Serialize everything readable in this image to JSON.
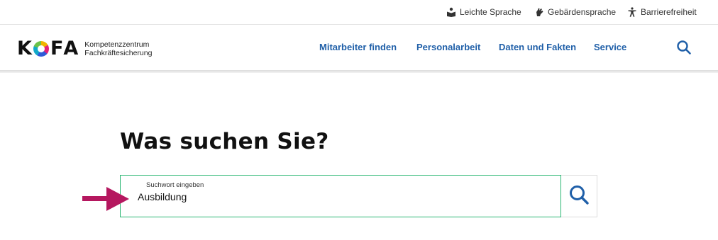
{
  "utility": {
    "easy_language": "Leichte Sprache",
    "sign_language": "Gebärdensprache",
    "accessibility": "Barrierefreiheit"
  },
  "logo": {
    "letter_k": "K",
    "letter_f": "F",
    "letter_a": "A",
    "tagline_1": "Kompetenzzentrum",
    "tagline_2": "Fachkräftesicherung"
  },
  "nav": {
    "items": [
      {
        "label": "Mitarbeiter finden"
      },
      {
        "label": "Personalarbeit"
      },
      {
        "label": "Daten und Fakten"
      },
      {
        "label": "Service"
      }
    ]
  },
  "search": {
    "title": "Was suchen Sie?",
    "field_label": "Suchwort eingeben",
    "value": "Ausbildung"
  },
  "colors": {
    "nav_link": "#1f5fa8",
    "field_border": "#2bb673",
    "arrow": "#b5175f",
    "icon_blue": "#1f5fa8"
  },
  "icons": {
    "easy_language": "book-reader-icon",
    "sign_language": "hand-sign-icon",
    "accessibility": "person-accessibility-icon",
    "search": "search-icon",
    "annotation": "arrow-right-icon"
  }
}
